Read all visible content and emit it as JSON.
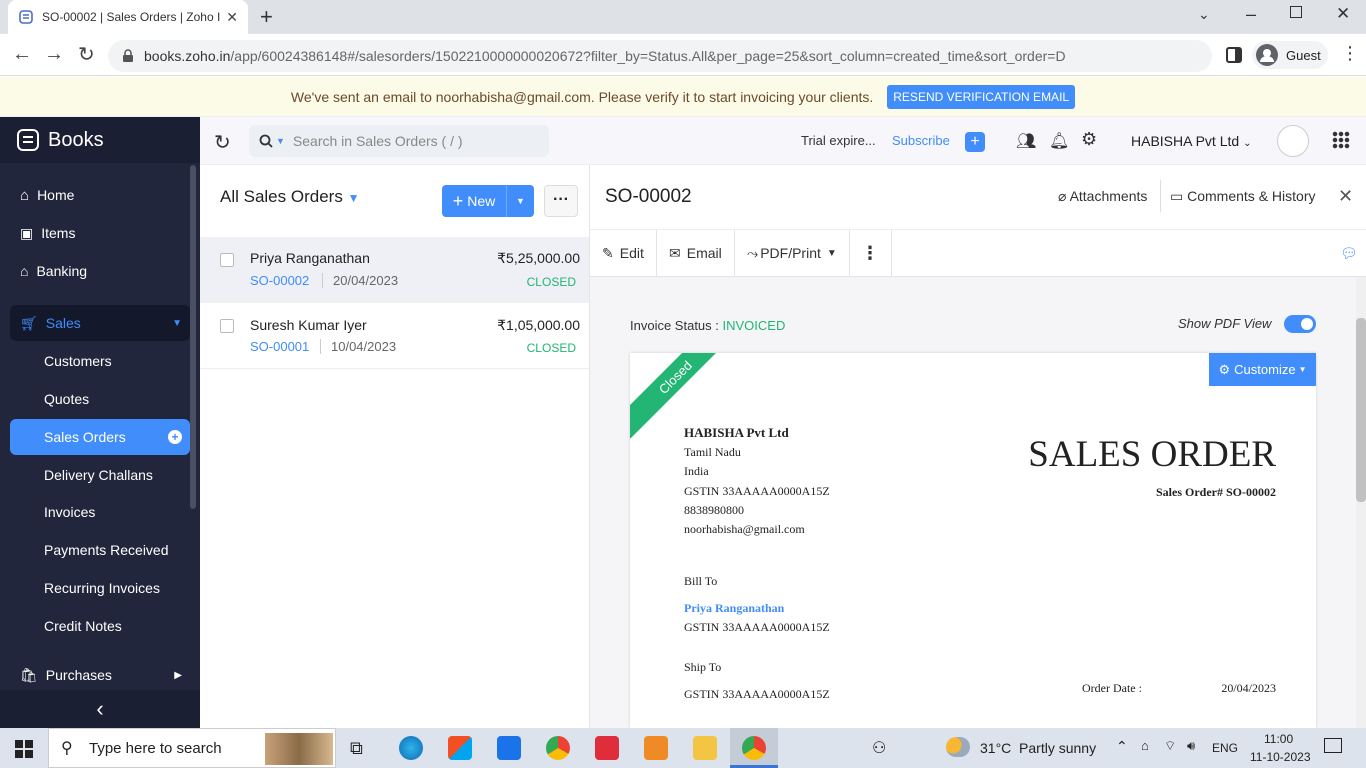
{
  "browser": {
    "tab_title": "SO-00002 | Sales Orders | Zoho I",
    "url_domain": "books.zoho.in",
    "url_path": "/app/60024386148#/salesorders/1502210000000020672?filter_by=Status.All&per_page=25&sort_column=created_time&sort_order=D",
    "profile_label": "Guest"
  },
  "banner": {
    "message": "We've sent an email to noorhabisha@gmail.com. Please verify it to start invoicing your clients.",
    "button_label": "RESEND VERIFICATION EMAIL"
  },
  "app": {
    "name": "Books"
  },
  "sidebar": {
    "items": [
      {
        "label": "Home",
        "icon": "home-icon"
      },
      {
        "label": "Items",
        "icon": "bag-icon"
      },
      {
        "label": "Banking",
        "icon": "bank-icon"
      },
      {
        "label": "Sales",
        "icon": "cart-icon"
      },
      {
        "label": "Customers"
      },
      {
        "label": "Quotes"
      },
      {
        "label": "Sales Orders",
        "active": true
      },
      {
        "label": "Delivery Challans"
      },
      {
        "label": "Invoices"
      },
      {
        "label": "Payments Received"
      },
      {
        "label": "Recurring Invoices"
      },
      {
        "label": "Credit Notes"
      },
      {
        "label": "Purchases",
        "icon": "basket-icon"
      }
    ],
    "collapse_glyph": "‹"
  },
  "header": {
    "search_placeholder": "Search in Sales Orders ( / )",
    "trial_text": "Trial expire...",
    "subscribe_label": "Subscribe",
    "org_name": "HABISHA Pvt Ltd"
  },
  "list": {
    "title": "All Sales Orders",
    "new_label": "New",
    "rows": [
      {
        "customer": "Priya Ranganathan",
        "number": "SO-00002",
        "date": "20/04/2023",
        "amount": "₹5,25,000.00",
        "status": "CLOSED"
      },
      {
        "customer": "Suresh Kumar Iyer",
        "number": "SO-00001",
        "date": "10/04/2023",
        "amount": "₹1,05,000.00",
        "status": "CLOSED"
      }
    ]
  },
  "detail": {
    "title": "SO-00002",
    "attachments_label": "Attachments",
    "comments_label": "Comments & History",
    "toolbar": {
      "edit": "Edit",
      "email": "Email",
      "pdf": "PDF/Print"
    },
    "invoice_status_label": "Invoice Status :",
    "invoice_status_value": "INVOICED",
    "pdf_view_label": "Show PDF View",
    "customize_label": "Customize",
    "ribbon_label": "Closed"
  },
  "document": {
    "company": "HABISHA Pvt Ltd",
    "state": "Tamil Nadu",
    "country": "India",
    "gstin": "GSTIN 33AAAAA0000A15Z",
    "phone": "8838980800",
    "email": "noorhabisha@gmail.com",
    "heading": "SALES ORDER",
    "order_no": "Sales Order# SO-00002",
    "bill_to_label": "Bill To",
    "bill_to_name": "Priya Ranganathan",
    "bill_to_gstin": "GSTIN 33AAAAA0000A15Z",
    "ship_to_label": "Ship To",
    "ship_to_gstin": "GSTIN 33AAAAA0000A15Z",
    "order_date_label": "Order Date :",
    "order_date": "20/04/2023"
  },
  "taskbar": {
    "search_placeholder": "Type here to search",
    "weather": "31°C  Partly sunny",
    "lang": "ENG",
    "time": "11:00",
    "date": "11-10-2023"
  },
  "colors": {
    "accent": "#408dfb",
    "sidebar": "#21263c",
    "success": "#22b573",
    "link": "#408dfb"
  }
}
